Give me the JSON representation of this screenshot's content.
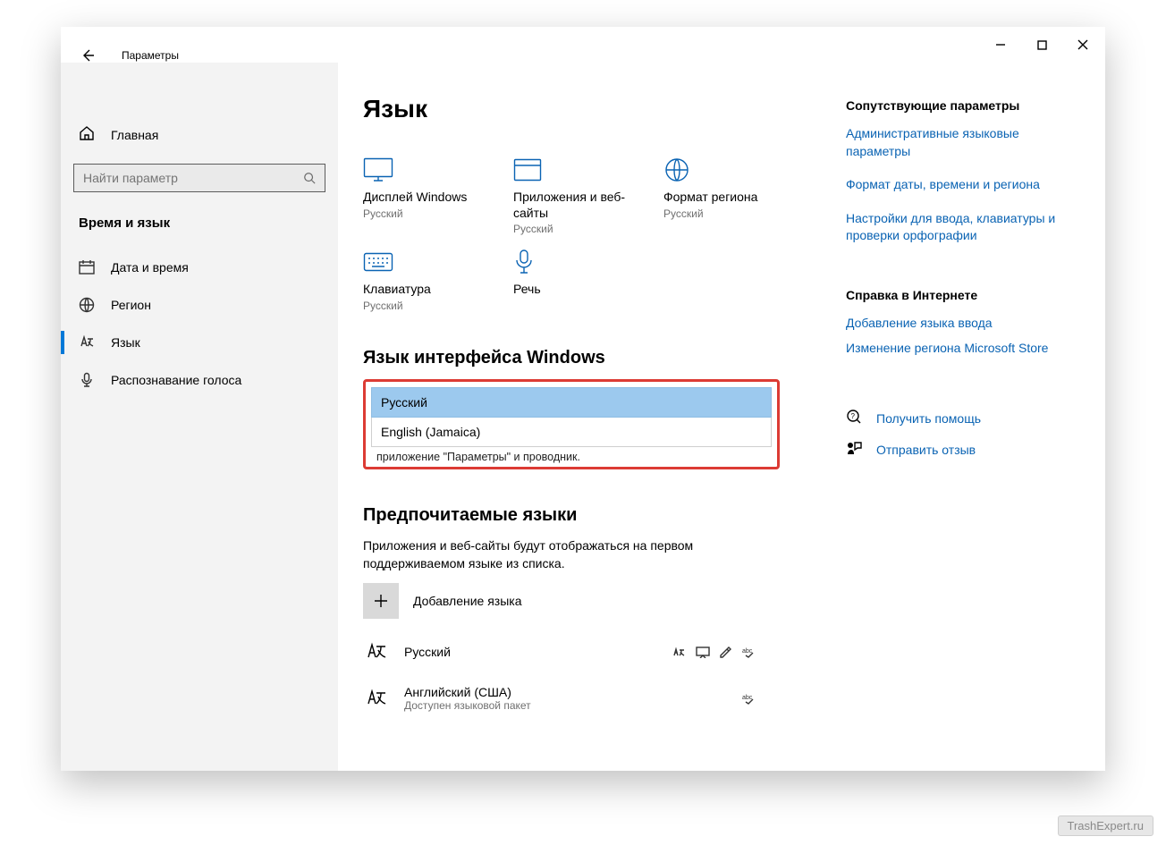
{
  "app_title": "Параметры",
  "page_title": "Язык",
  "search_placeholder": "Найти параметр",
  "home_label": "Главная",
  "section_title": "Время и язык",
  "nav": [
    {
      "label": "Дата и время"
    },
    {
      "label": "Регион"
    },
    {
      "label": "Язык"
    },
    {
      "label": "Распознавание голоса"
    }
  ],
  "tiles": [
    {
      "label": "Дисплей Windows",
      "sub": "Русский"
    },
    {
      "label": "Приложения и веб-сайты",
      "sub": "Русский"
    },
    {
      "label": "Формат региона",
      "sub": "Русский"
    },
    {
      "label": "Клавиатура",
      "sub": "Русский"
    },
    {
      "label": "Речь",
      "sub": ""
    }
  ],
  "display_lang": {
    "heading": "Язык интерфейса Windows",
    "options": [
      "Русский",
      "English (Jamaica)"
    ],
    "below": "приложение \"Параметры\" и проводник."
  },
  "preferred": {
    "heading": "Предпочитаемые языки",
    "desc": "Приложения и веб-сайты будут отображаться на первом поддерживаемом языке из списка.",
    "add": "Добавление языка",
    "items": [
      {
        "name": "Русский",
        "sub": ""
      },
      {
        "name": "Английский (США)",
        "sub": "Доступен языковой пакет"
      }
    ]
  },
  "right": {
    "related_heading": "Сопутствующие параметры",
    "links": [
      "Административные языковые параметры",
      "Формат даты, времени и региона",
      "Настройки для ввода, клавиатуры и проверки орфографии"
    ],
    "help_heading": "Справка в Интернете",
    "help_links": [
      "Добавление языка ввода",
      "Изменение региона Microsoft Store"
    ],
    "get_help": "Получить помощь",
    "feedback": "Отправить отзыв"
  },
  "watermark": "TrashExpert.ru"
}
